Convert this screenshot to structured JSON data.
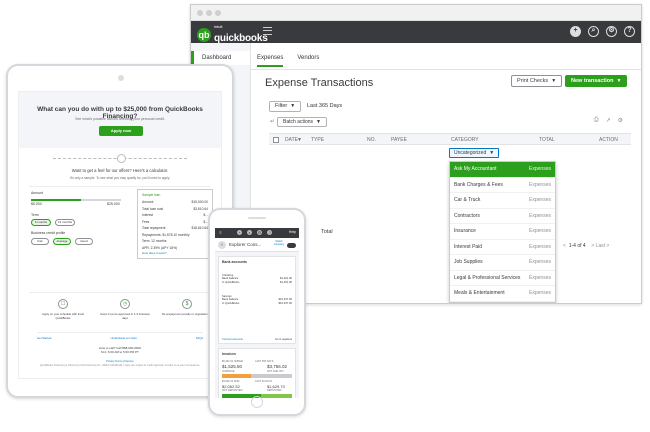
{
  "desktop": {
    "brand": {
      "small": "intuit",
      "word": "quickbooks"
    },
    "topbar_icons": [
      "plus-icon",
      "search-icon",
      "gear-icon",
      "help-icon"
    ],
    "sidebar": {
      "items": [
        {
          "label": "Dashboard"
        }
      ]
    },
    "tabs": [
      {
        "label": "Expenses"
      },
      {
        "label": "Vendors"
      }
    ],
    "title": "Expense Transactions",
    "print_checks_label": "Print Checks",
    "new_transaction_label": "New transaction",
    "filter_label": "Filter",
    "date_range": "Last 365 Days",
    "batch_actions_label": "Batch actions",
    "table": {
      "columns": [
        "DATE",
        "TYPE",
        "NO.",
        "PAYEE",
        "CATEGORY",
        "TOTAL",
        "ACTION"
      ],
      "category_value": "Uncategorized",
      "total_label": "Total",
      "pager_text": "1-4 of 4",
      "last_label": "Last"
    },
    "dropdown": {
      "items": [
        {
          "name": "Ask My Accountant",
          "type": "Expenses"
        },
        {
          "name": "Bank Charges & Fees",
          "type": "Expenses"
        },
        {
          "name": "Car & Truck",
          "type": "Expenses"
        },
        {
          "name": "Contractors",
          "type": "Expenses"
        },
        {
          "name": "Insurance",
          "type": "Expenses"
        },
        {
          "name": "Interest Paid",
          "type": "Expenses"
        },
        {
          "name": "Job Supplies",
          "type": "Expenses"
        },
        {
          "name": "Legal & Professional Services",
          "type": "Expenses"
        },
        {
          "name": "Meals & Entertainment",
          "type": "Expenses"
        }
      ],
      "selected_index": 0
    },
    "accent": "#2ca01c",
    "bar_color": "#393a3d"
  },
  "tablet": {
    "headline": "What can you do with up to $25,000 from QuickBooks Financing?",
    "subline": "See what's possible without affecting your personal credit.",
    "apply_label": "Apply now",
    "question": "Want to get a feel for our offers? Here's a calculator.",
    "question_sub": "It's only a sample. To see what you may qualify for, you'll need to apply.",
    "amount_label": "Amount",
    "amount_min": "$5,000",
    "amount_max": "$25,000",
    "term_label": "Term",
    "term_options": [
      "6 months",
      "12 months"
    ],
    "profile_label": "Business credit profile",
    "profile_options": [
      "Fair",
      "Average",
      "Good"
    ],
    "card": {
      "title": "Sample loan",
      "rows": [
        {
          "label": "Amount",
          "value": "$15,000.00"
        },
        {
          "label": "Total loan cost",
          "value": "$3,810.64"
        },
        {
          "label": "Interest",
          "value": "$..."
        },
        {
          "label": "Fees",
          "value": "$..."
        },
        {
          "label": "Total repayment",
          "value": "$18,810.64"
        },
        {
          "label": "Repayments: $1,578.10 monthly",
          "value": ""
        },
        {
          "label": "Term: 12 months",
          "value": ""
        },
        {
          "label": "APR: 2.39% (APY 18%)",
          "value": ""
        }
      ],
      "link": "How does it work?"
    },
    "benefits": [
      {
        "icon": "document-icon",
        "text": "Apply on your schedule with Intuit QuickBooks"
      },
      {
        "icon": "clock-icon",
        "text": "Know if you're approved in 1-3 business days"
      },
      {
        "icon": "money-icon",
        "text": "No prepayment penalty or origination fee"
      }
    ],
    "links": [
      "Get Started",
      "Understand our rates",
      "FAQs"
    ],
    "contact_line1": "How to call? Call 888-000-0000",
    "contact_line2": "M-F, 6:00 AM to 5:00 PM PT",
    "footer_links": "Privacy  Terms of Service",
    "footer_text": "QuickBooks Financing is offered by Intuit Financing Inc. (NMLS #1136148). Loans are subject to credit approval. Contact us at your convenience."
  },
  "phone": {
    "company": "Explorer Cons...",
    "switch_label": "Switch company",
    "bank_title": "Bank accounts",
    "accounts": [
      {
        "name": "Checking",
        "left1": "Bank balance",
        "left2": "In QuickBooks",
        "right1": "$1,201.00",
        "right2": "$1,301.00"
      },
      {
        "name": "Savings",
        "left1": "Bank balance",
        "left2": "In QuickBooks",
        "right1": "$16,337.00",
        "right2": "$16,337.00"
      }
    ],
    "connect_label": "Connect accounts",
    "go_label": "Go to registers",
    "invoices_title": "Invoices",
    "unpaid_label": "$5,281.52 UNPAID",
    "last365_label": "LAST 365 DAYS",
    "overdue_amt": "$1,525.50",
    "overdue_lbl": "OVERDUE",
    "notdue_amt": "$3,756.02",
    "notdue_lbl": "NOT DUE YET",
    "paid_label": "$3,692.22 PAID",
    "paid_sub": "LAST 30 DAYS",
    "deposited_amt": "$2,062.52",
    "deposited_lbl": "NOT DEPOSITED",
    "deposited2_amt": "$1,629.70",
    "deposited2_lbl": "DEPOSITED",
    "overdue_color": "#f2a03d",
    "notdue_color": "#c9cbce",
    "paid_color": "#2ca01c",
    "deposited_color": "#7fc745"
  }
}
